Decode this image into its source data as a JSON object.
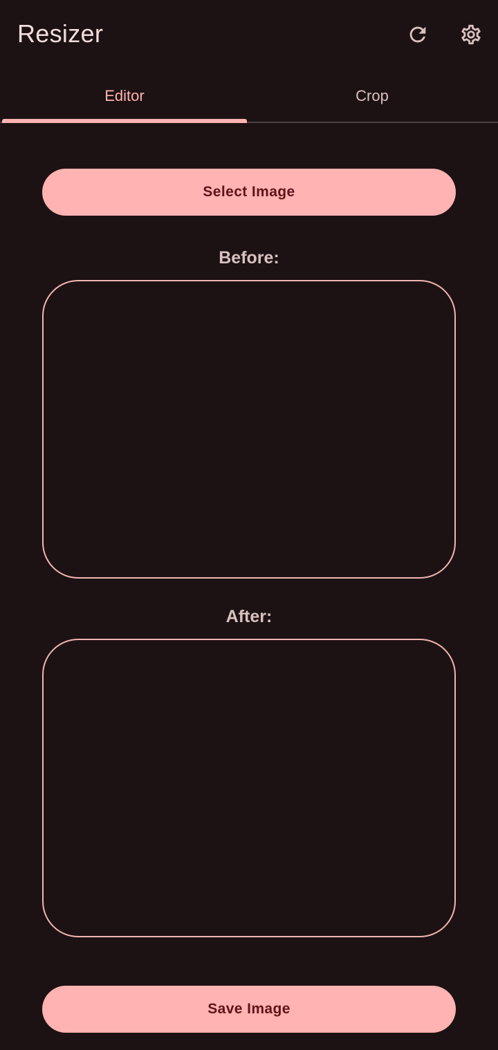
{
  "app": {
    "title": "Resizer"
  },
  "toolbar": {
    "actions": [
      {
        "icon": "refresh-icon"
      },
      {
        "icon": "gear-icon"
      }
    ]
  },
  "tabs": [
    {
      "label": "Editor",
      "selected": true
    },
    {
      "label": "Crop",
      "selected": false
    }
  ],
  "editor": {
    "select_button_label": "Select Image",
    "before_label": "Before:",
    "after_label": "After:",
    "save_button_label": "Save Image"
  },
  "colors": {
    "background": "#1d1213",
    "accent": "#ffb3b2",
    "on_accent": "#5f1319",
    "text_primary": "#f1dedd",
    "text_secondary": "#d8c1c0"
  }
}
